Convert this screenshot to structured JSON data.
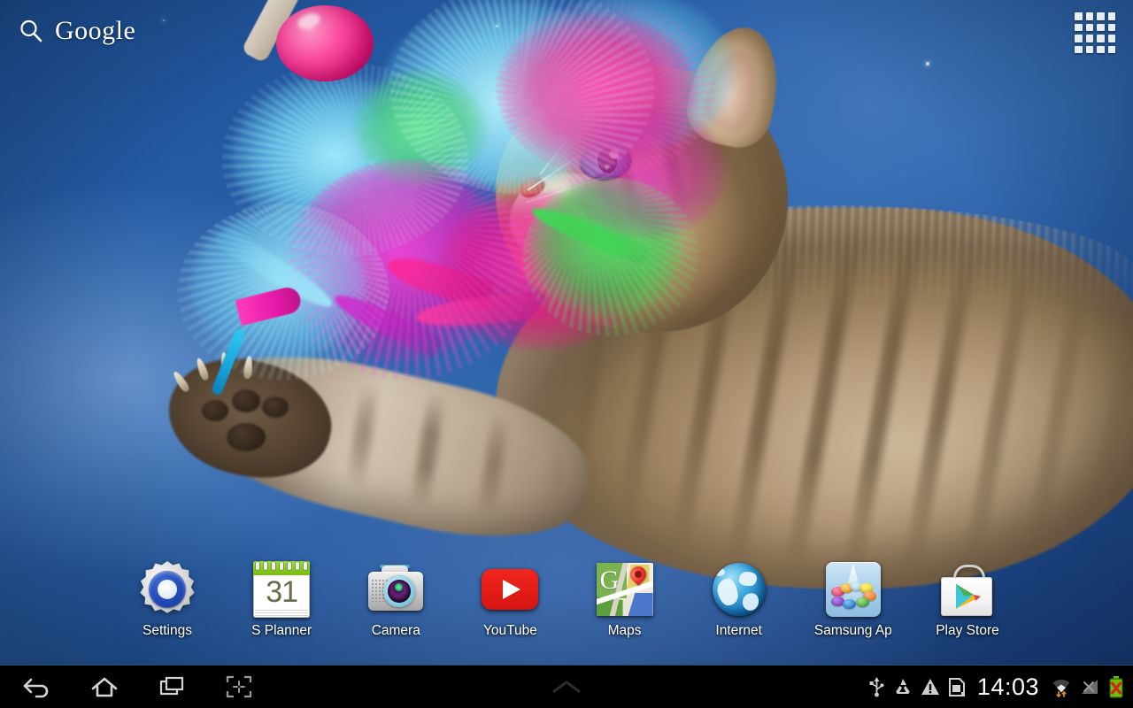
{
  "device": {
    "platform": "Android tablet home screen",
    "orientation": "landscape"
  },
  "wallpaper": {
    "subject": "kitten playing with a feather toy",
    "description": "Brown tabby kitten reaching up with claws extended toward a pink, cyan and green feather wand toy with a pink ball, against a deep blue studio background",
    "colors": {
      "background_dark": "#1a4183",
      "background_mid": "#2a64ad",
      "background_light": "#6e9ad2",
      "fur_light": "#e7d9c2",
      "fur_mid": "#b59b7a",
      "fur_dark": "#6b5740",
      "feather_pink": "#e7187f",
      "feather_magenta": "#c01ad0",
      "feather_cyan": "#5ed8f5",
      "feather_green": "#32d448",
      "ball_pink": "#fb4ea1",
      "eye_blue": "#4e8fb5"
    }
  },
  "search_widget": {
    "icon": "search-icon",
    "label": "Google"
  },
  "app_drawer": {
    "icon": "apps-grid-icon",
    "label": "Apps",
    "rows": 4,
    "columns": 4
  },
  "dock": {
    "apps": [
      {
        "label": "Settings",
        "icon": "settings-gear-icon"
      },
      {
        "label": "S Planner",
        "icon": "calendar-icon",
        "badge": "31"
      },
      {
        "label": "Camera",
        "icon": "camera-icon"
      },
      {
        "label": "YouTube",
        "icon": "youtube-icon"
      },
      {
        "label": "Maps",
        "icon": "maps-icon",
        "glyph": "G"
      },
      {
        "label": "Internet",
        "icon": "globe-icon"
      },
      {
        "label": "Samsung Ap",
        "icon": "samsung-apps-icon"
      },
      {
        "label": "Play Store",
        "icon": "play-store-icon"
      }
    ]
  },
  "navigation_bar": {
    "buttons": [
      {
        "name": "back",
        "icon": "back-arrow-icon"
      },
      {
        "name": "home",
        "icon": "home-icon"
      },
      {
        "name": "recents",
        "icon": "recent-apps-icon"
      },
      {
        "name": "screenshot",
        "icon": "screen-capture-icon"
      }
    ],
    "notification_handle": {
      "icon": "chevron-up-icon"
    }
  },
  "status_bar": {
    "time": "14:03",
    "icons": [
      {
        "name": "usb",
        "icon": "usb-icon"
      },
      {
        "name": "recycle",
        "icon": "recycle-icon"
      },
      {
        "name": "warning",
        "icon": "warning-triangle-icon"
      },
      {
        "name": "sd-card",
        "icon": "sd-card-icon"
      },
      {
        "name": "wifi",
        "icon": "wifi-icon"
      },
      {
        "name": "mobile-signal",
        "icon": "signal-off-icon"
      },
      {
        "name": "battery",
        "icon": "battery-error-icon"
      }
    ],
    "colors": {
      "text": "#ffffff",
      "icon": "#d8d8d8",
      "battery_green": "#6ec007",
      "battery_error": "#d42020",
      "wifi_arrow": "#e08a2a"
    }
  }
}
